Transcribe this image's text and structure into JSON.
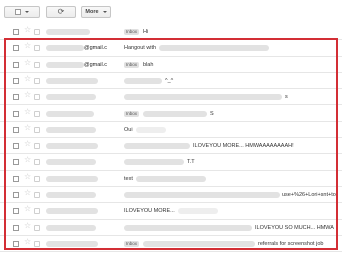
{
  "toolbar": {
    "select_caret": "caret-down-icon",
    "refresh_icon": "refresh-icon",
    "refresh_glyph": "⟳",
    "more_label": "More",
    "more_caret": "caret-down-icon"
  },
  "emails": [
    {
      "sender_tail": "",
      "label": "Inbox",
      "subject": "Hi",
      "subject_tail": ""
    },
    {
      "sender_tail": "@gmail.c",
      "label": "",
      "subject": "Hangout with",
      "subject_tail": ""
    },
    {
      "sender_tail": "@gmail.c",
      "label": "Inbox",
      "subject": "blah",
      "subject_tail": ""
    },
    {
      "sender_tail": "",
      "label": "",
      "subject": "^_^",
      "subject_tail": ""
    },
    {
      "sender_tail": "",
      "label": "",
      "subject": "",
      "subject_tail": "s"
    },
    {
      "sender_tail": "",
      "label": "Inbox",
      "subject": "",
      "subject_tail": "S"
    },
    {
      "sender_tail": "",
      "label": "",
      "subject": "Oui",
      "subject_tail": ""
    },
    {
      "sender_tail": "",
      "label": "",
      "subject": "",
      "subject_tail": "ILOVEYOU MORE... HMWAAAAAAAAH!"
    },
    {
      "sender_tail": "",
      "label": "",
      "subject": "",
      "subject_tail": "T.T"
    },
    {
      "sender_tail": "",
      "label": "",
      "subject": "text",
      "subject_tail": ""
    },
    {
      "sender_tail": "",
      "label": "",
      "subject": "",
      "subject_tail": "use+%26+Lori+snt+to"
    },
    {
      "sender_tail": "",
      "label": "",
      "subject": "ILOVEYOU MORE...",
      "subject_tail": ""
    },
    {
      "sender_tail": "",
      "label": "",
      "subject": "",
      "subject_tail": "ILOVEYOU SO MUCH... HMWA"
    },
    {
      "sender_tail": "",
      "label": "Inbox",
      "subject": "",
      "subject_tail": "referrals for screenshot job"
    }
  ],
  "colors": {
    "highlight_border": "#d32e35",
    "row_border": "#e6e6e6"
  }
}
